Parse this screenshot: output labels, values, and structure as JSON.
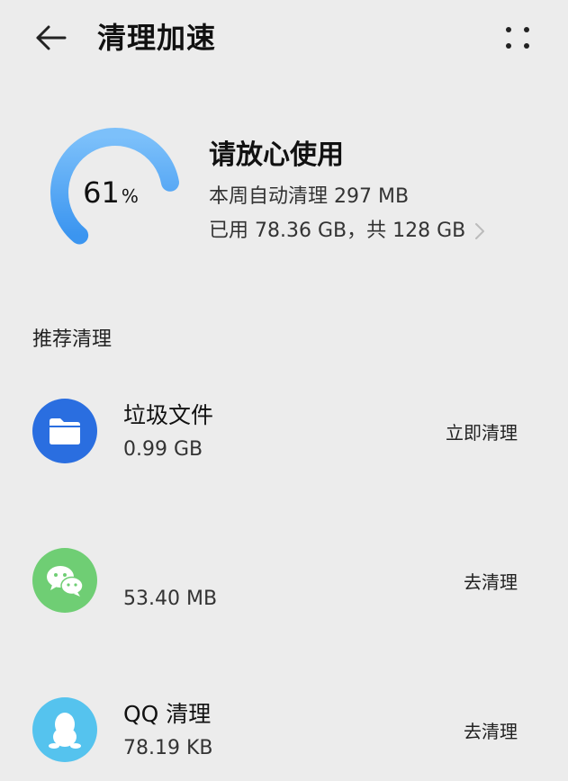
{
  "header": {
    "title": "清理加速",
    "back_icon": "arrow-left-icon",
    "more_icon": "more-dots-icon"
  },
  "storage": {
    "percent_value": "61",
    "percent_sign": "%",
    "percent_fraction": 0.61,
    "status": "请放心使用",
    "weekly_auto_clean": "本周自动清理 297 MB",
    "usage": "已用 78.36 GB，共 128 GB",
    "ring_color": "#3b95f0",
    "ring_color_light": "#7cc0fa"
  },
  "recommend": {
    "title": "推荐清理",
    "items": [
      {
        "title": "垃圾文件",
        "size": "0.99 GB",
        "action": "立即清理",
        "icon": "folder-icon",
        "icon_bg": "#2a6ee0"
      },
      {
        "title": "",
        "size": "53.40 MB",
        "action": "去清理",
        "icon": "wechat-icon",
        "icon_bg": "#6fce74"
      },
      {
        "title": "QQ 清理",
        "size": "78.19 KB",
        "action": "去清理",
        "icon": "qq-penguin-icon",
        "icon_bg": "#55c3ee"
      }
    ]
  }
}
